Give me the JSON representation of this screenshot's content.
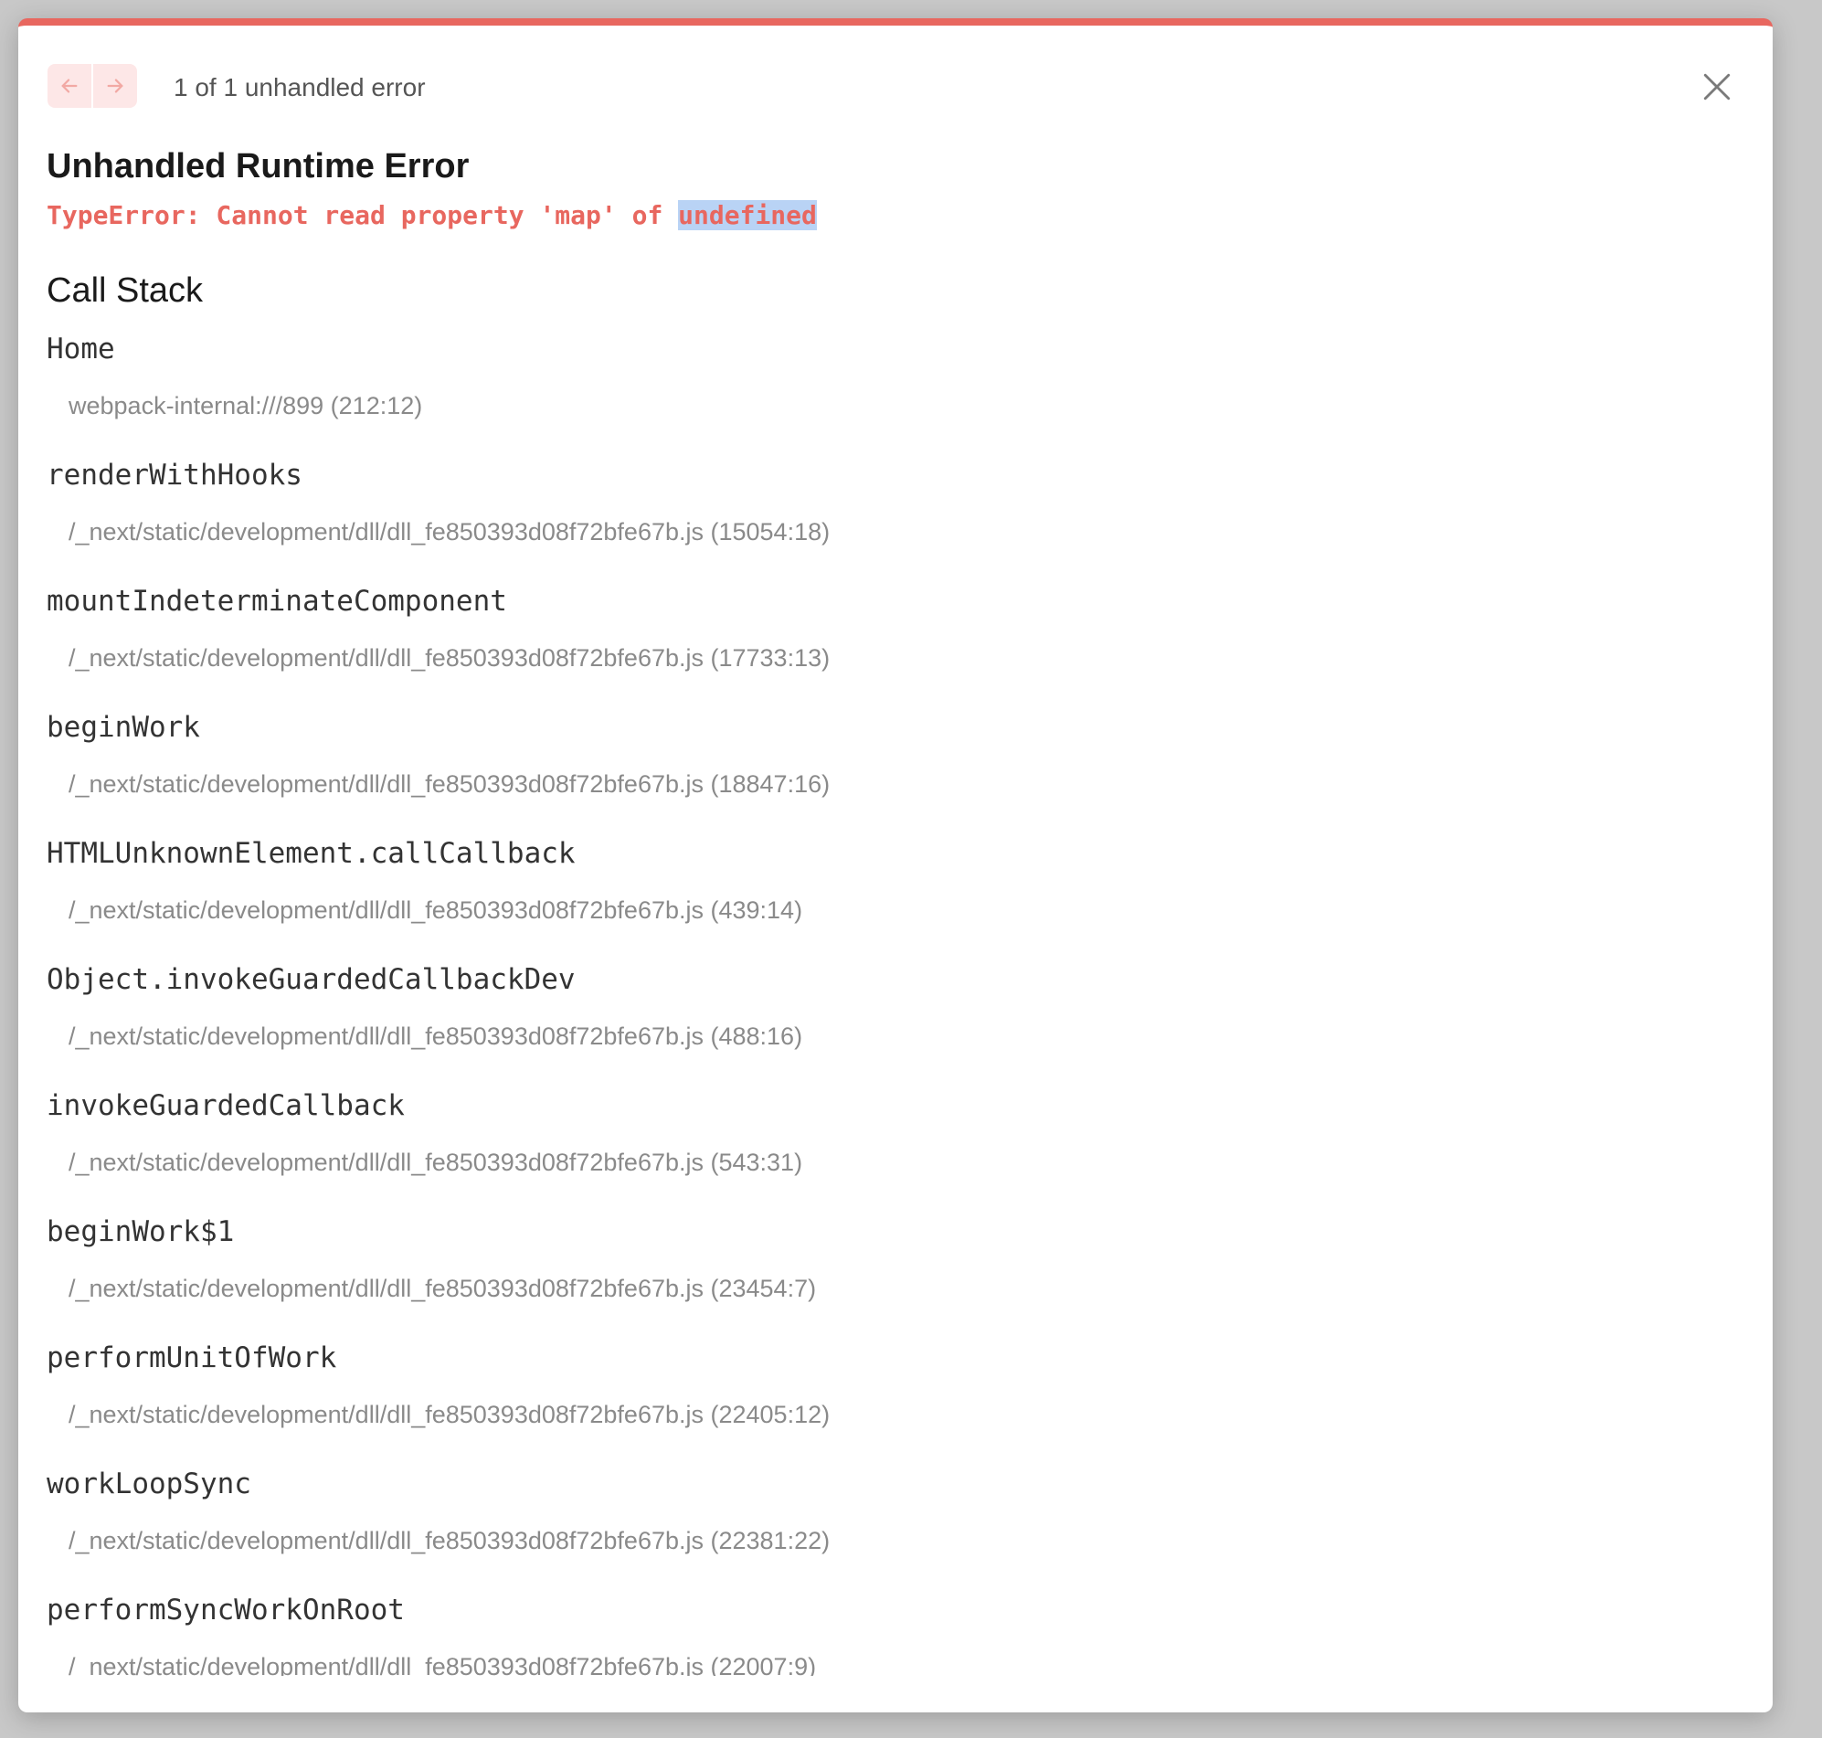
{
  "header": {
    "error_count": "1 of 1 unhandled error"
  },
  "error": {
    "title": "Unhandled Runtime Error",
    "message_prefix": "TypeError: Cannot read property 'map' of ",
    "message_highlight": "undefined"
  },
  "call_stack": {
    "title": "Call Stack",
    "frames": [
      {
        "fn": "Home",
        "loc": "webpack-internal:///899 (212:12)"
      },
      {
        "fn": "renderWithHooks",
        "loc": "/_next/static/development/dll/dll_fe850393d08f72bfe67b.js (15054:18)"
      },
      {
        "fn": "mountIndeterminateComponent",
        "loc": "/_next/static/development/dll/dll_fe850393d08f72bfe67b.js (17733:13)"
      },
      {
        "fn": "beginWork",
        "loc": "/_next/static/development/dll/dll_fe850393d08f72bfe67b.js (18847:16)"
      },
      {
        "fn": "HTMLUnknownElement.callCallback",
        "loc": "/_next/static/development/dll/dll_fe850393d08f72bfe67b.js (439:14)"
      },
      {
        "fn": "Object.invokeGuardedCallbackDev",
        "loc": "/_next/static/development/dll/dll_fe850393d08f72bfe67b.js (488:16)"
      },
      {
        "fn": "invokeGuardedCallback",
        "loc": "/_next/static/development/dll/dll_fe850393d08f72bfe67b.js (543:31)"
      },
      {
        "fn": "beginWork$1",
        "loc": "/_next/static/development/dll/dll_fe850393d08f72bfe67b.js (23454:7)"
      },
      {
        "fn": "performUnitOfWork",
        "loc": "/_next/static/development/dll/dll_fe850393d08f72bfe67b.js (22405:12)"
      },
      {
        "fn": "workLoopSync",
        "loc": "/_next/static/development/dll/dll_fe850393d08f72bfe67b.js (22381:22)"
      },
      {
        "fn": "performSyncWorkOnRoot",
        "loc": "/_next/static/development/dll/dll_fe850393d08f72bfe67b.js (22007:9)"
      }
    ]
  },
  "colors": {
    "accent": "#e8675f",
    "highlight": "#b9d3f5",
    "nav_bg": "#fde7e7"
  },
  "icons": {
    "prev": "arrow-left-icon",
    "next": "arrow-right-icon",
    "close": "close-icon"
  }
}
